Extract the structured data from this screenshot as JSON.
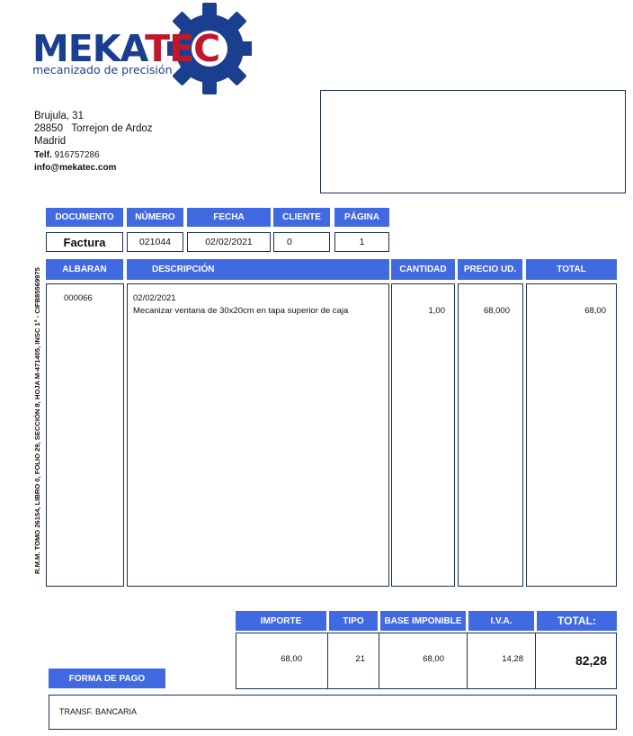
{
  "company": {
    "name_part1": "MEKA",
    "name_part2": "TEC",
    "tagline": "mecanizado de precisión",
    "address_line1": "Brujula, 31",
    "address_line2": "28850   Torrejon de Ardoz",
    "address_line3": "Madrid",
    "phone_label": "Telf.",
    "phone": "916757286",
    "email": "info@mekatec.com",
    "registry": "R.M.M. TOMO 26154, LIBRO 0, FOLIO 29, SECCIÓN 8, HOJA M-471405, INSC 1ª - CIFB85569975"
  },
  "doc_header": {
    "labels": [
      "DOCUMENTO",
      "NÚMERO",
      "FECHA",
      "CLIENTE",
      "PÁGINA"
    ],
    "values": [
      "Factura",
      "021044",
      "02/02/2021",
      "0",
      "1"
    ]
  },
  "items": {
    "headers": [
      "ALBARAN",
      "DESCRIPCIÓN",
      "CANTIDAD",
      "PRECIO UD.",
      "TOTAL"
    ],
    "rows": [
      {
        "albaran": "000066",
        "date": "02/02/2021",
        "description": "Mecanizar ventana de 30x20cm en tapa superior de caja",
        "cantidad": "1,00",
        "precio": "68,000",
        "total": "68,00"
      }
    ]
  },
  "totals": {
    "headers": [
      "IMPORTE",
      "TIPO",
      "BASE IMPONIBLE",
      "I.V.A.",
      "TOTAL:"
    ],
    "values": [
      "68,00",
      "21",
      "68,00",
      "14,28",
      "82,28"
    ]
  },
  "payment": {
    "label": "FORMA DE PAGO",
    "value": "TRANSF. BANCARIA"
  },
  "colors": {
    "brand_blue": "#1b3f8f",
    "brand_red": "#c0182b",
    "header_blue": "#4169e1",
    "border": "#1c3054"
  }
}
